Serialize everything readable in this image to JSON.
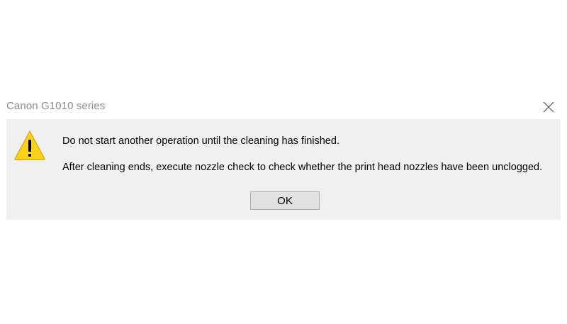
{
  "dialog": {
    "title": "Canon G1010 series",
    "icon": "warning-icon",
    "messages": [
      "Do not start another operation until the cleaning has finished.",
      "After cleaning ends, execute nozzle check to check whether the print head nozzles have been unclogged."
    ],
    "ok_label": "OK",
    "close_icon": "close-icon"
  },
  "colors": {
    "content_background": "#f0f0f0",
    "button_background": "#e1e1e1",
    "button_border": "#adadad",
    "warning_yellow": "#fcd116",
    "title_text": "#8c8c8c"
  }
}
